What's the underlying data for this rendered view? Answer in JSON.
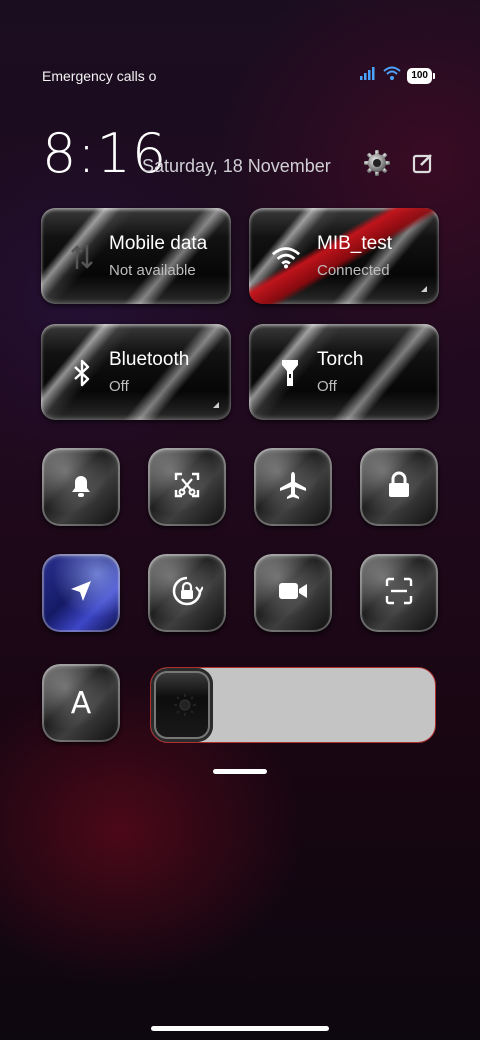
{
  "status": {
    "left_text": "Emergency calls o",
    "battery": "100"
  },
  "header": {
    "time": "8:16",
    "date": "Saturday, 18 November",
    "settings_icon": "gear-icon",
    "edit_icon": "edit-icon"
  },
  "tiles": [
    {
      "title": "Mobile data",
      "subtitle": "Not available",
      "icon": "mobile-data-icon"
    },
    {
      "title": "MIB_test",
      "subtitle": "Connected",
      "icon": "wifi-icon"
    },
    {
      "title": "Bluetooth",
      "subtitle": "Off",
      "icon": "bluetooth-icon"
    },
    {
      "title": "Torch",
      "subtitle": "Off",
      "icon": "torch-icon"
    }
  ],
  "toggles_row1": [
    "bell-icon",
    "screenshot-icon",
    "airplane-icon",
    "lock-icon"
  ],
  "toggles_row2": [
    "location-icon",
    "rotation-lock-icon",
    "screen-record-icon",
    "scanner-icon"
  ],
  "font_button": {
    "label": "A"
  },
  "brightness": {
    "level": 0.2
  },
  "colors": {
    "accent_blue": "#2a2f8f",
    "wifi_stripe": "#c8141c",
    "slider_track": "#c4c4c4"
  }
}
